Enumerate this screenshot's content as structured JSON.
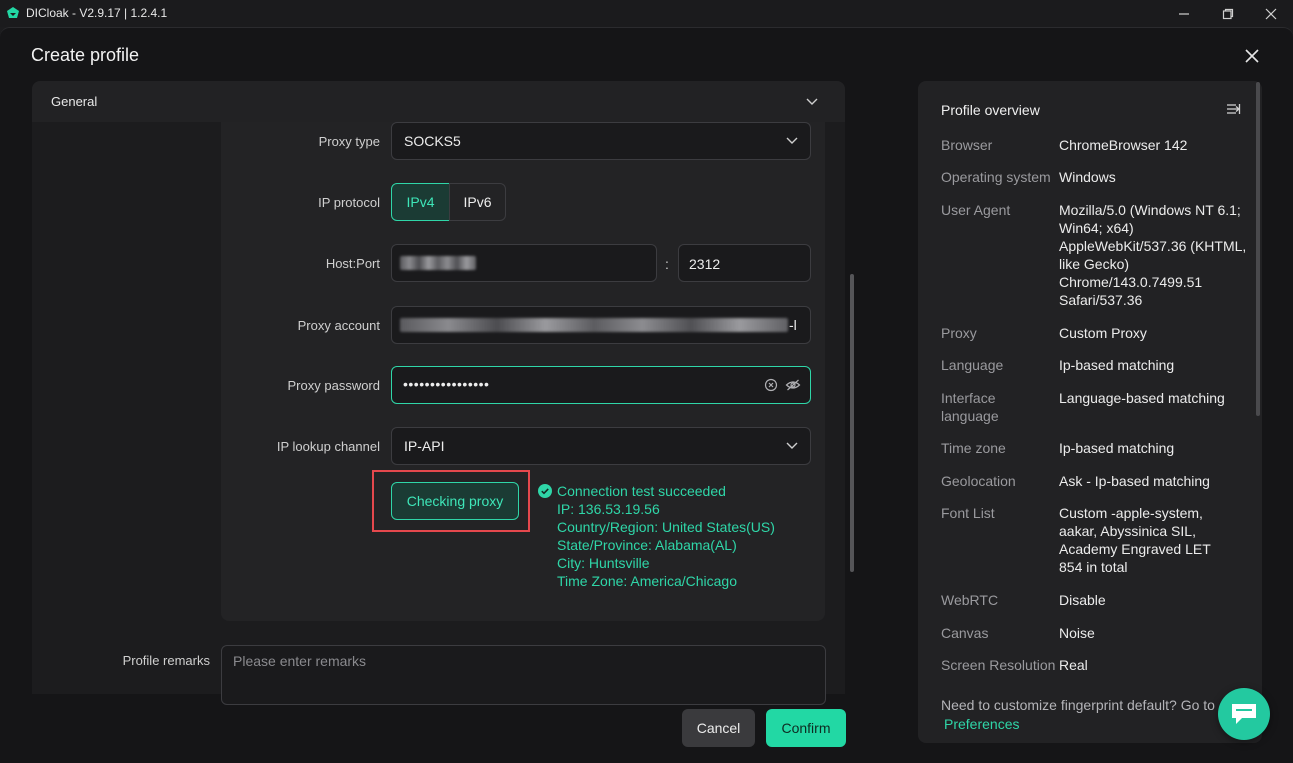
{
  "app": {
    "title": "DICloak - V2.9.17 | 1.2.4.1",
    "accent": "#22d8a4"
  },
  "modal": {
    "title": "Create profile"
  },
  "section": {
    "general_label": "General"
  },
  "proxy": {
    "type_label": "Proxy type",
    "type_value": "SOCKS5",
    "ip_protocol_label": "IP protocol",
    "ip_protocol_options": [
      "IPv4",
      "IPv6"
    ],
    "ip_protocol_selected": "IPv4",
    "host_port_label": "Host:Port",
    "port_separator": ":",
    "port_value": "2312",
    "account_label": "Proxy account",
    "account_suffix": "-l",
    "password_label": "Proxy password",
    "password_value": "••••••••••••••••",
    "lookup_label": "IP lookup channel",
    "lookup_value": "IP-API",
    "check_button": "Checking proxy"
  },
  "result": {
    "status": "Connection test succeeded",
    "ip": "IP: 136.53.19.56",
    "country": "Country/Region: United States(US)",
    "state": "State/Province: Alabama(AL)",
    "city": "City: Huntsville",
    "timezone": "Time Zone: America/Chicago"
  },
  "remarks": {
    "label": "Profile remarks",
    "placeholder": "Please enter remarks"
  },
  "footer": {
    "cancel": "Cancel",
    "confirm": "Confirm"
  },
  "overview": {
    "title": "Profile overview",
    "items": [
      {
        "k": "Browser",
        "v": "ChromeBrowser 142"
      },
      {
        "k": "Operating system",
        "v": "Windows"
      },
      {
        "k": "User Agent",
        "v": "Mozilla/5.0 (Windows NT 6.1; Win64; x64) AppleWebKit/537.36 (KHTML, like Gecko) Chrome/143.0.7499.51 Safari/537.36"
      },
      {
        "k": "Proxy",
        "v": "Custom Proxy"
      },
      {
        "k": "Language",
        "v": "Ip-based matching"
      },
      {
        "k": "Interface language",
        "v": "Language-based matching"
      },
      {
        "k": "Time zone",
        "v": "Ip-based matching"
      },
      {
        "k": "Geolocation",
        "v": "Ask - Ip-based matching"
      },
      {
        "k": "Font List",
        "v": "Custom -apple-system, aakar, Abyssinica SIL, Academy Engraved LET 854 in total"
      },
      {
        "k": "WebRTC",
        "v": "Disable"
      },
      {
        "k": "Canvas",
        "v": "Noise"
      },
      {
        "k": "Screen Resolution",
        "v": "Real"
      }
    ],
    "footer_text": "Need to customize fingerprint default? Go to",
    "footer_link": "Preferences"
  }
}
